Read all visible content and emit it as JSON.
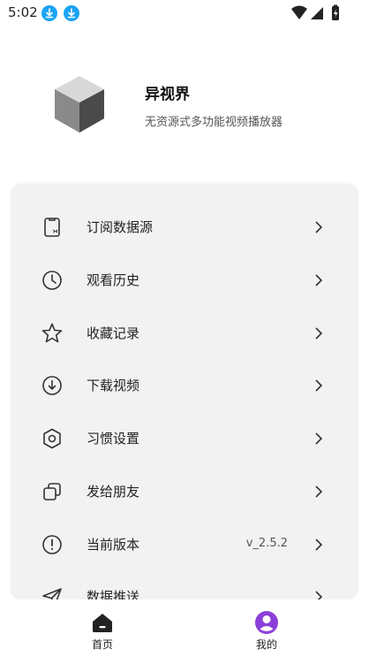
{
  "status_bar": {
    "time": "5:02"
  },
  "app": {
    "name": "异视界",
    "description": "无资源式多功能视频播放器"
  },
  "menu": {
    "items": [
      {
        "label": "订阅数据源",
        "icon": "subscription-source-icon",
        "value": ""
      },
      {
        "label": "观看历史",
        "icon": "clock-icon",
        "value": ""
      },
      {
        "label": "收藏记录",
        "icon": "star-icon",
        "value": ""
      },
      {
        "label": "下载视频",
        "icon": "download-icon",
        "value": ""
      },
      {
        "label": "习惯设置",
        "icon": "hexagon-settings-icon",
        "value": ""
      },
      {
        "label": "发给朋友",
        "icon": "share-icon",
        "value": ""
      },
      {
        "label": "当前版本",
        "icon": "info-icon",
        "value": "v_2.5.2"
      },
      {
        "label": "数据推送",
        "icon": "send-icon",
        "value": ""
      }
    ]
  },
  "bottom_nav": {
    "home_label": "首页",
    "mine_label": "我的"
  },
  "colors": {
    "accent": "#8b3fd9",
    "card_bg": "#f2f2f2",
    "status_download": "#1aa3f5"
  }
}
